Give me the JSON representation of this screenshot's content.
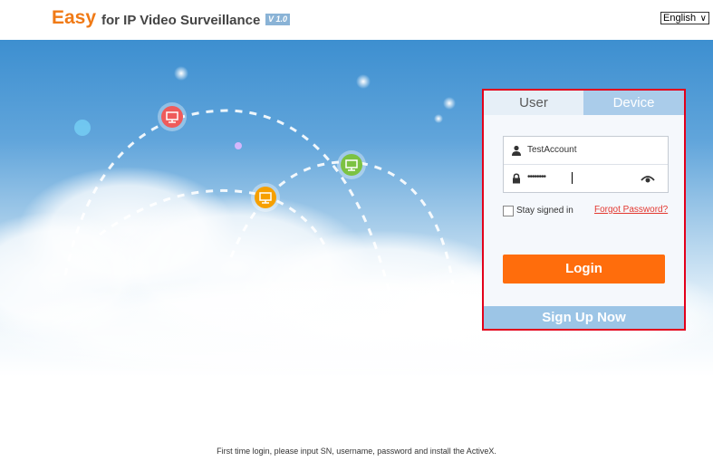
{
  "header": {
    "brand": "Easy",
    "product": "for IP Video Surveillance",
    "version": "V 1.0",
    "language": "English"
  },
  "login_panel": {
    "tabs": [
      {
        "label": "User",
        "active": false
      },
      {
        "label": "Device",
        "active": true
      }
    ],
    "username_value": "TestAccount",
    "password_mask": "••••••••",
    "stay_signed_in_label": "Stay signed in",
    "stay_signed_in_checked": false,
    "forgot_label": "Forgot Password?",
    "login_label": "Login",
    "signup_label": "Sign Up Now"
  },
  "footer": {
    "hint": "First time login, please input SN, username, password and install the ActiveX."
  },
  "icons": [
    "user-icon",
    "lock-icon",
    "eye-icon",
    "monitor-icon"
  ],
  "colors": {
    "brand_orange": "#f07a16",
    "login_button": "#ff6d0c",
    "highlight_border": "#e3001b",
    "signup_bar": "#9cc5e6",
    "tab_active": "#aaccea"
  }
}
